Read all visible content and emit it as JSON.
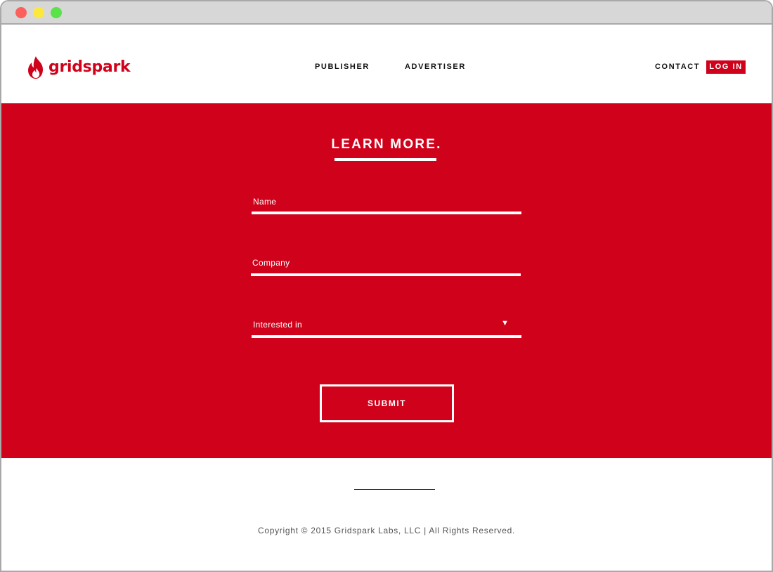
{
  "header": {
    "brand": "gridspark",
    "nav": {
      "publisher": "PUBLISHER",
      "advertiser": "ADVERTISER",
      "contact": "CONTACT",
      "login": "LOG IN"
    }
  },
  "form": {
    "title": "LEARN MORE.",
    "name_label": "Name",
    "company_label": "Company",
    "interested_label": "Interested in",
    "select_arrow": "▼",
    "submit_label": "SUBMIT"
  },
  "footer": {
    "copyright": "Copyright © 2015 Gridspark Labs, LLC | All Rights Reserved."
  },
  "colors": {
    "brand": "#d0021b",
    "text_dark": "#111111",
    "white": "#ffffff"
  },
  "icons": {
    "logo": "flame-icon",
    "dropdown": "triangle-down-icon"
  }
}
